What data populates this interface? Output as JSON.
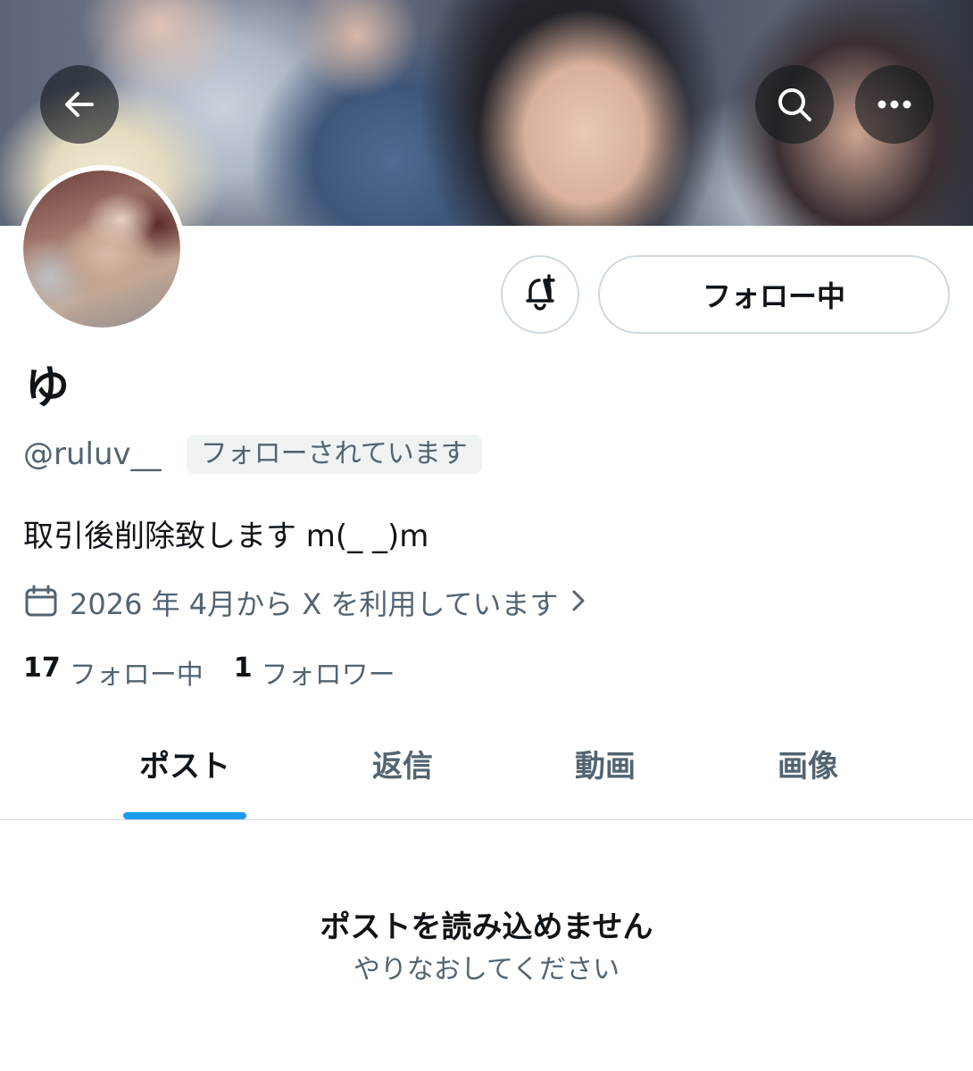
{
  "header": {
    "back_icon": "arrow-left-icon",
    "search_icon": "search-icon",
    "more_icon": "more-horizontal-icon"
  },
  "profile": {
    "display_name": "ゆ",
    "handle": "@ruluv__",
    "follows_you_badge": "フォローされています",
    "bio": "取引後削除致します m(_ _)m",
    "joined": "2026 年 4月から X を利用しています",
    "following_count": "17",
    "following_label": "フォロー中",
    "followers_count": "1",
    "followers_label": "フォロワー"
  },
  "actions": {
    "notify_icon": "bell-plus-icon",
    "follow_button_label": "フォロー中"
  },
  "tabs": [
    {
      "label": "ポスト",
      "active": true
    },
    {
      "label": "返信",
      "active": false
    },
    {
      "label": "動画",
      "active": false
    },
    {
      "label": "画像",
      "active": false
    }
  ],
  "empty_state": {
    "title": "ポストを読み込めません",
    "subtitle": "やりなおしてください"
  },
  "colors": {
    "accent": "#1d9bf0",
    "text_primary": "#0f1419",
    "text_secondary": "#536471",
    "border": "#cfd9de"
  }
}
